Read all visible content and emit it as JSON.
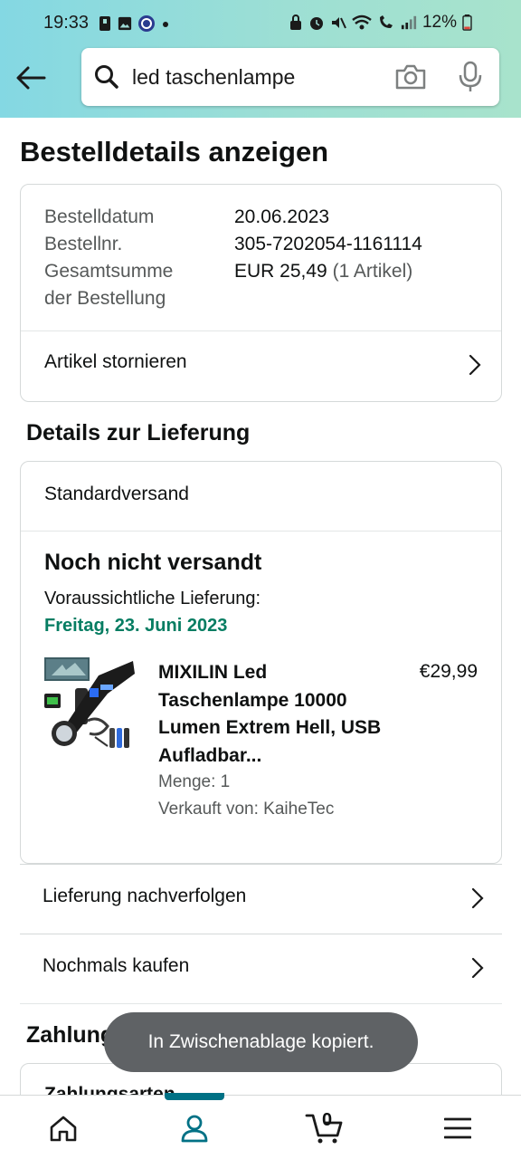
{
  "status_bar": {
    "time": "19:33",
    "battery_percent": "12%"
  },
  "search": {
    "query": "led taschenlampe"
  },
  "page": {
    "title": "Bestelldetails anzeigen"
  },
  "order_summary": {
    "date_label": "Bestelldatum",
    "date_value": "20.06.2023",
    "number_label": "Bestellnr.",
    "number_value": "305-7202054-1161114",
    "total_label_line1": "Gesamtsumme",
    "total_label_line2": "der Bestellung",
    "total_value": "EUR 25,49",
    "total_items": "(1 Artikel)",
    "cancel_label": "Artikel stornieren"
  },
  "delivery": {
    "heading": "Details zur Lieferung",
    "shipping_method": "Standardversand",
    "status": "Noch nicht versandt",
    "expected_label": "Voraussichtliche Lieferung:",
    "expected_date": "Freitag, 23. Juni 2023",
    "product": {
      "title": "MIXILIN Led Taschenlampe 10000 Lumen Extrem Hell, USB Aufladbar...",
      "price": "€29,99",
      "quantity": "Menge: 1",
      "seller": "Verkauft von: KaiheTec"
    },
    "track_label": "Lieferung nachverfolgen",
    "buy_again_label": "Nochmals kaufen"
  },
  "payment": {
    "heading": "Zahlungsinformation",
    "methods_label": "Zahlungsarten"
  },
  "toast": {
    "message": "In Zwischenablage kopiert."
  },
  "bottom_nav": {
    "cart_count": "0"
  },
  "colors": {
    "header_start": "#84d8e3",
    "header_end": "#a8e3cc",
    "accent_green": "#067d62",
    "active_teal": "#007185"
  }
}
